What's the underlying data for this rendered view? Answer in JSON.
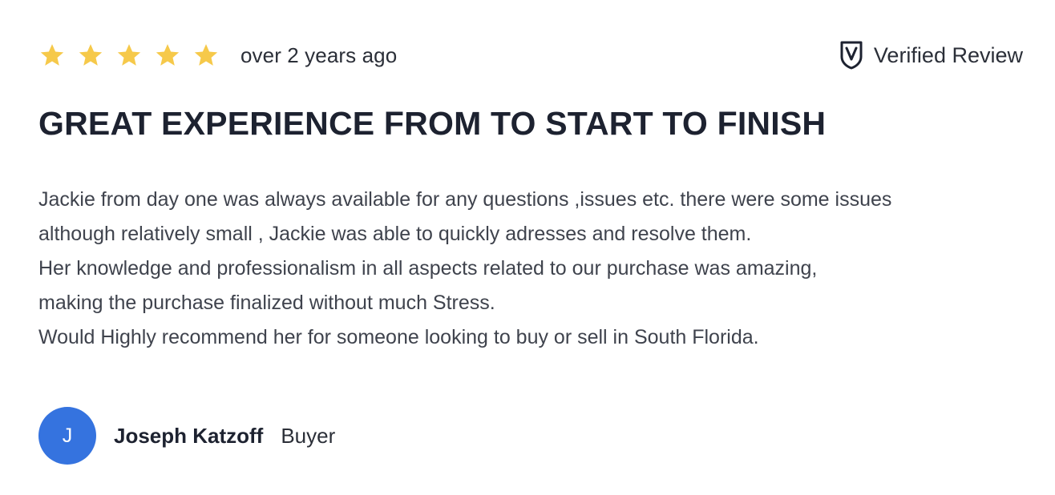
{
  "review": {
    "rating": 5,
    "rating_max": 5,
    "time_ago": "over 2 years ago",
    "verified_label": "Verified Review",
    "title": "GREAT EXPERIENCE FROM TO START TO FINISH",
    "body_lines": [
      "Jackie from day one was always available for any questions ,issues etc. there were some issues",
      "although relatively small , Jackie was able to quickly adresses and resolve them.",
      "Her knowledge and professionalism  in all aspects related to our purchase was amazing,",
      "making the purchase finalized  without much Stress.",
      "Would Highly recommend her for someone looking to buy or sell in South Florida."
    ],
    "author": {
      "initial": "J",
      "name": "Joseph Katzoff",
      "role": "Buyer"
    }
  },
  "icons": {
    "star": "star-icon",
    "verified": "shield-check-icon"
  },
  "colors": {
    "star": "#f6c94a",
    "avatar": "#3573df",
    "title": "#1d2230",
    "body": "#3f434d"
  }
}
